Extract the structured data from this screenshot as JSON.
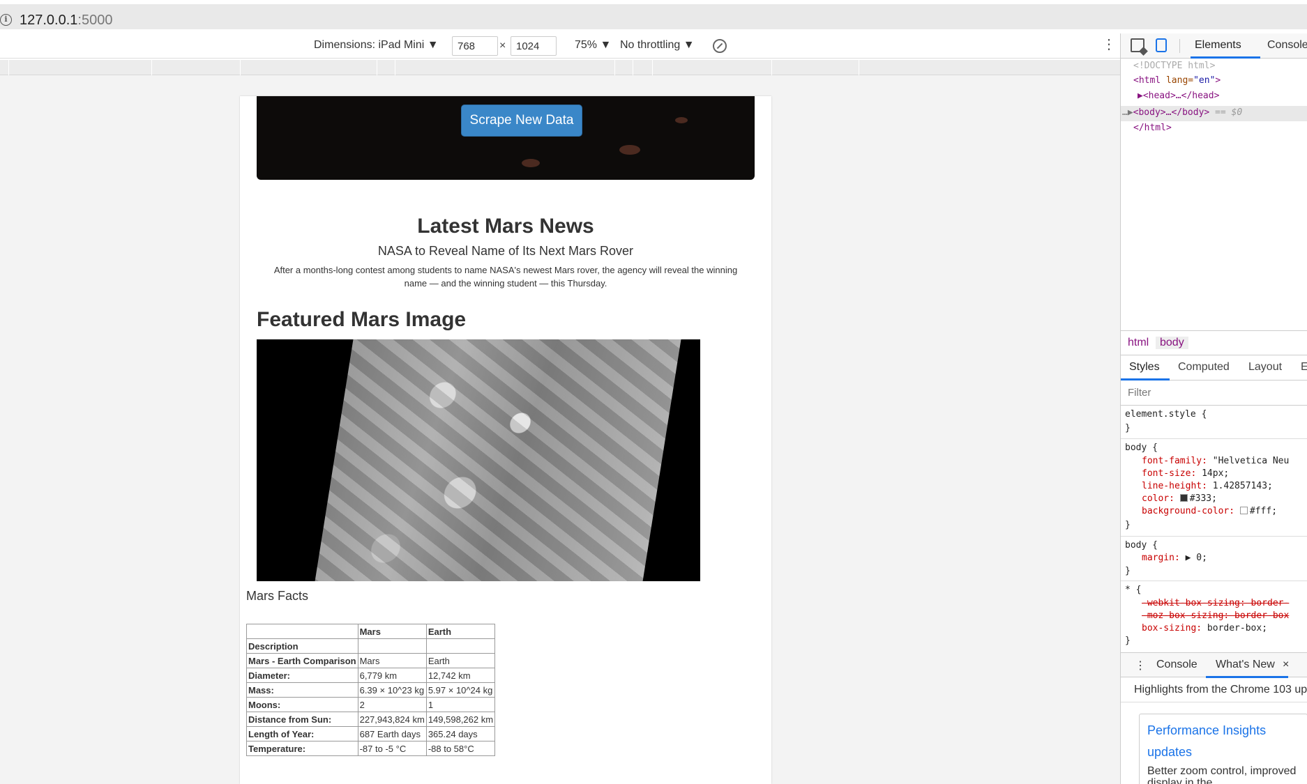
{
  "browser": {
    "url_host": "127.0.0.1",
    "url_port": ":5000"
  },
  "device_toolbar": {
    "dimensions_label": "Dimensions: iPad Mini ▼",
    "width": "768",
    "height": "1024",
    "times": "×",
    "zoom": "75% ▼",
    "throttling": "No throttling ▼",
    "more": "⋮"
  },
  "page": {
    "scrape_button": "Scrape New Data",
    "news_heading": "Latest Mars News",
    "news_title": "NASA to Reveal Name of Its Next Mars Rover",
    "news_paragraph": "After a months-long contest among students to name NASA's newest Mars rover, the agency will reveal the winning name — and the winning student — this Thursday.",
    "featured_heading": "Featured Mars Image",
    "facts_heading": "Mars Facts",
    "facts_table": {
      "headers": [
        "",
        "Mars",
        "Earth"
      ],
      "rows": [
        [
          "Description",
          "",
          ""
        ],
        [
          "Mars - Earth Comparison",
          "Mars",
          "Earth"
        ],
        [
          "Diameter:",
          "6,779 km",
          "12,742 km"
        ],
        [
          "Mass:",
          "6.39 × 10^23 kg",
          "5.97 × 10^24 kg"
        ],
        [
          "Moons:",
          "2",
          "1"
        ],
        [
          "Distance from Sun:",
          "227,943,824 km",
          "149,598,262 km"
        ],
        [
          "Length of Year:",
          "687 Earth days",
          "365.24 days"
        ],
        [
          "Temperature:",
          "-87 to -5 °C",
          "-88 to 58°C"
        ]
      ]
    }
  },
  "devtools": {
    "tabs": {
      "elements": "Elements",
      "console": "Console"
    },
    "dom": {
      "doctype": "<!DOCTYPE html>",
      "html_open_tag": "<html",
      "html_attr": " lang=",
      "html_attr_val": "\"en\"",
      "html_close_bracket": ">",
      "head": "▶<head>…</head>",
      "body_prefix": "…▶",
      "body": "<body>…</body>",
      "body_suffix": " == $0",
      "html_close": "</html>"
    },
    "breadcrumbs": [
      "html",
      "body"
    ],
    "styles_tabs": {
      "styles": "Styles",
      "computed": "Computed",
      "layout": "Layout",
      "more": "E"
    },
    "filter_placeholder": "Filter",
    "rules": {
      "element_style": "element.style {",
      "close": "}",
      "body_sel": "body {",
      "font_family_prop": "font-family:",
      "font_family_val": "\"Helvetica Neu",
      "font_size_prop": "font-size:",
      "font_size_val": "14px;",
      "line_height_prop": "line-height:",
      "line_height_val": "1.42857143;",
      "color_prop": "color:",
      "color_val": "#333;",
      "color_swatch": "#333333",
      "bg_prop": "background-color:",
      "bg_val": "#fff;",
      "bg_swatch": "#ffffff",
      "margin_prop": "margin:",
      "margin_val": "▶ 0;",
      "star_sel": "* {",
      "webkit": "-webkit-box-sizing: border-",
      "moz": "-moz-box-sizing: border-box",
      "box_sizing_prop": "box-sizing:",
      "box_sizing_val": "border-box;"
    },
    "drawer": {
      "more": "⋮",
      "console": "Console",
      "whats_new": "What's New",
      "close": "×",
      "highlights": "Highlights from the Chrome 103 up",
      "card_title": "Performance Insights updates",
      "card_body": "Better zoom control, improved display in the"
    }
  },
  "colors": {
    "button_blue": "#3a87c8",
    "devtools_accent": "#1a73e8",
    "tag_purple": "#881280",
    "prop_red": "#c80000"
  }
}
